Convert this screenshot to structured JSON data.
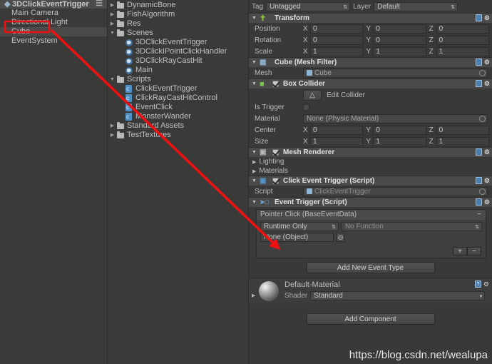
{
  "hierarchy": {
    "scene_header": "3DClickEventTrigger",
    "items": [
      {
        "label": "Main Camera",
        "selected": false
      },
      {
        "label": "Directional Light",
        "selected": false
      },
      {
        "label": "Cube",
        "selected": true
      },
      {
        "label": "EventSystem",
        "selected": false
      }
    ]
  },
  "project": {
    "items": [
      {
        "label": "DynamicBone",
        "indent": 0,
        "twisty": "right",
        "icon": "folder-icon"
      },
      {
        "label": "FishAlgorithm",
        "indent": 0,
        "twisty": "right",
        "icon": "folder-icon"
      },
      {
        "label": "Res",
        "indent": 0,
        "twisty": "right",
        "icon": "folder-icon"
      },
      {
        "label": "Scenes",
        "indent": 0,
        "twisty": "down",
        "icon": "folder-icon"
      },
      {
        "label": "3DClickEventTrigger",
        "indent": 1,
        "twisty": "none",
        "icon": "unity-scene-icon"
      },
      {
        "label": "3DClickIPointClickHandler",
        "indent": 1,
        "twisty": "none",
        "icon": "unity-scene-icon"
      },
      {
        "label": "3DClickRayCastHit",
        "indent": 1,
        "twisty": "none",
        "icon": "unity-scene-icon"
      },
      {
        "label": "Main",
        "indent": 1,
        "twisty": "none",
        "icon": "unity-scene-icon"
      },
      {
        "label": "Scripts",
        "indent": 0,
        "twisty": "down",
        "icon": "folder-icon"
      },
      {
        "label": "ClickEventTrigger",
        "indent": 1,
        "twisty": "none",
        "icon": "csharp-script-icon"
      },
      {
        "label": "ClickRayCastHitControl",
        "indent": 1,
        "twisty": "none",
        "icon": "csharp-script-icon"
      },
      {
        "label": "EventClick",
        "indent": 1,
        "twisty": "none",
        "icon": "csharp-script-icon"
      },
      {
        "label": "MonsterWander",
        "indent": 1,
        "twisty": "none",
        "icon": "csharp-script-icon"
      },
      {
        "label": "Standard Assets",
        "indent": 0,
        "twisty": "right",
        "icon": "folder-icon"
      },
      {
        "label": "TestTextures",
        "indent": 0,
        "twisty": "right",
        "icon": "folder-icon"
      }
    ]
  },
  "inspector": {
    "tag_label": "Tag",
    "tag_value": "Untagged",
    "layer_label": "Layer",
    "layer_value": "Default",
    "transform": {
      "title": "Transform",
      "rows": [
        {
          "label": "Position",
          "x": "0",
          "y": "0",
          "z": "0"
        },
        {
          "label": "Rotation",
          "x": "0",
          "y": "0",
          "z": "0"
        },
        {
          "label": "Scale",
          "x": "1",
          "y": "1",
          "z": "1"
        }
      ],
      "axis_x": "X",
      "axis_y": "Y",
      "axis_z": "Z"
    },
    "mesh_filter": {
      "title": "Cube (Mesh Filter)",
      "mesh_label": "Mesh",
      "mesh_value": "Cube"
    },
    "box_collider": {
      "title": "Box Collider",
      "enabled": true,
      "edit_collider_label": "Edit Collider",
      "is_trigger_label": "Is Trigger",
      "is_trigger_checked": false,
      "material_label": "Material",
      "material_value": "None (Physic Material)",
      "center": {
        "label": "Center",
        "x": "0",
        "y": "0",
        "z": "0"
      },
      "size": {
        "label": "Size",
        "x": "1",
        "y": "1",
        "z": "1"
      }
    },
    "mesh_renderer": {
      "title": "Mesh Renderer",
      "enabled": true,
      "sections": [
        "Lighting",
        "Materials"
      ]
    },
    "click_event_trigger": {
      "title": "Click Event Trigger (Script)",
      "enabled": true,
      "script_label": "Script",
      "script_value": "ClickEventTrigger"
    },
    "event_trigger": {
      "title": "Event Trigger (Script)",
      "entry_title": "Pointer Click (BaseEventData)",
      "remove_entry_label": "−",
      "callback_mode": "Runtime Only",
      "function_value": "No Function",
      "object_value": "None (Object)",
      "add_label": "+",
      "remove_label": "−",
      "add_new_event_type_label": "Add New Event Type"
    },
    "material_block": {
      "name": "Default-Material",
      "shader_label": "Shader",
      "shader_value": "Standard"
    },
    "add_component_label": "Add Component"
  },
  "watermark": "https://blog.csdn.net/wealupa",
  "annotation": {
    "highlight_color": "#ee1111",
    "arrow_color": "#ee1111"
  }
}
